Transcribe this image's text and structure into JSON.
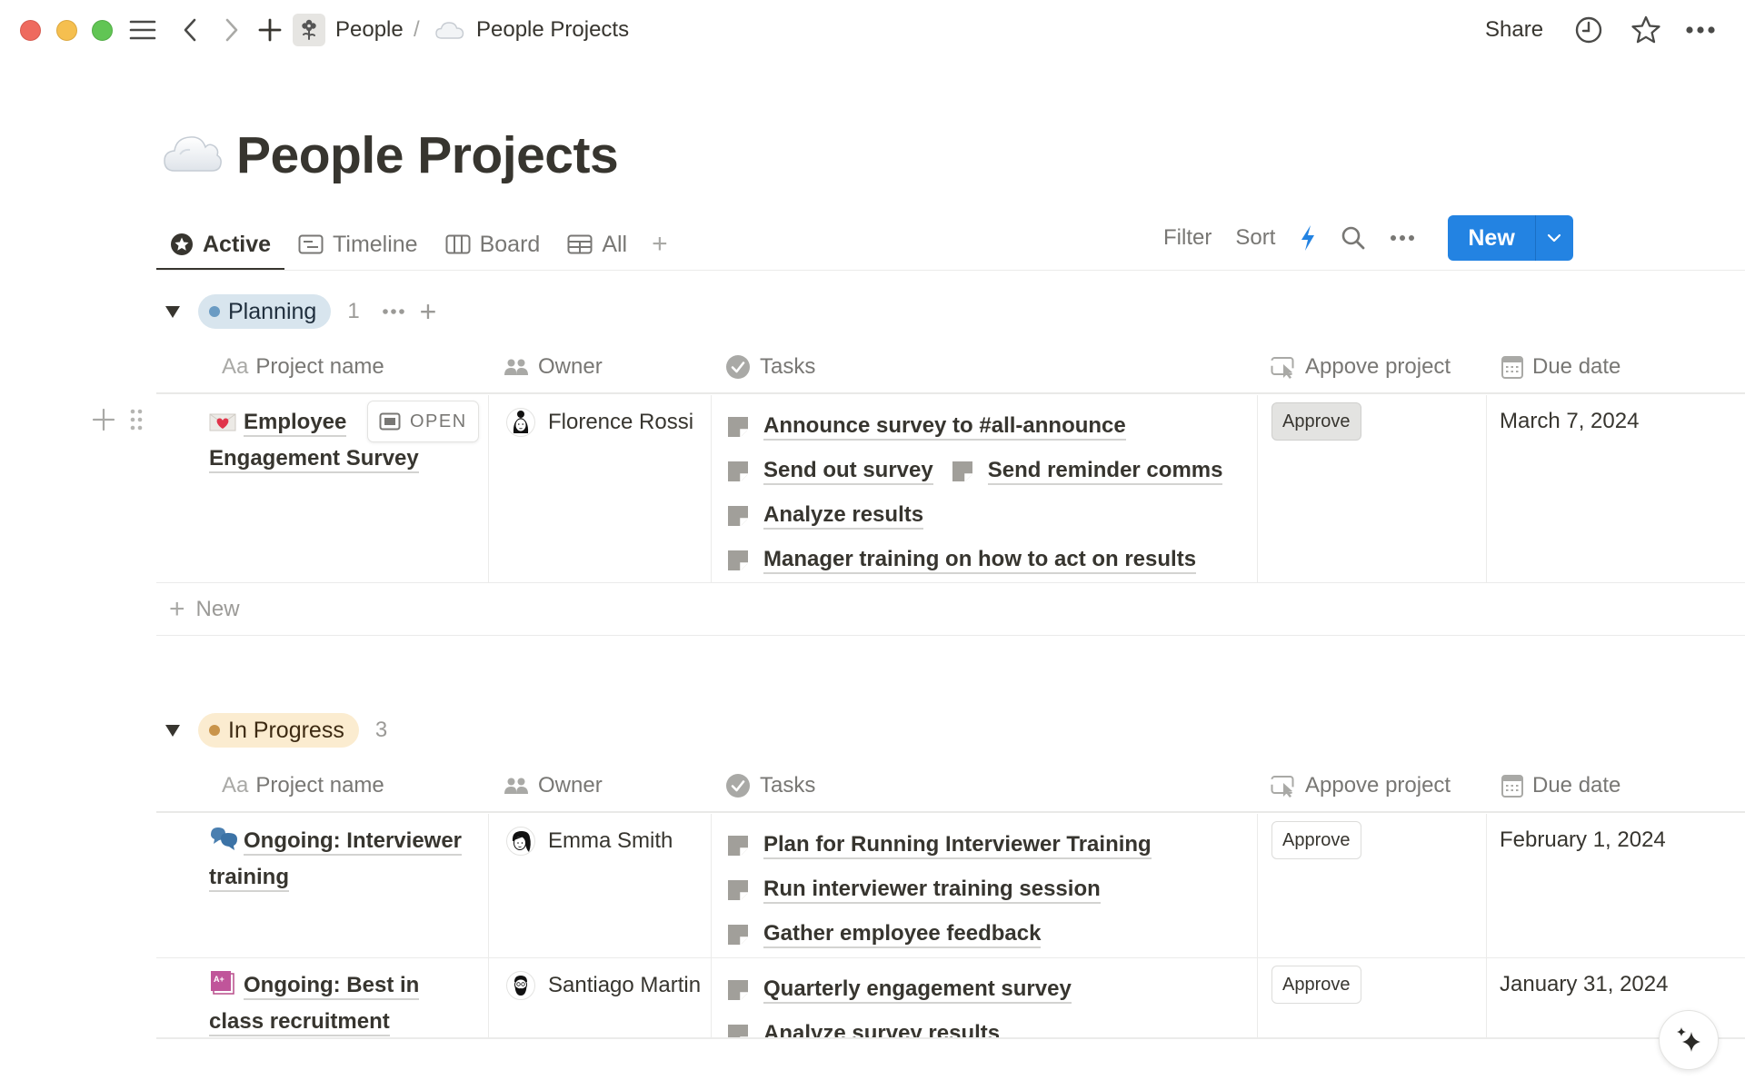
{
  "window": {
    "controls": [
      "close",
      "minimize",
      "maximize"
    ]
  },
  "topbar": {
    "breadcrumb": [
      {
        "label": "People",
        "icon": "flower-icon"
      },
      {
        "label": "People Projects",
        "icon": "cloud-icon"
      }
    ],
    "separator": "/",
    "share_label": "Share"
  },
  "page": {
    "icon": "cloud-icon",
    "title": "People Projects"
  },
  "views": {
    "tabs": [
      {
        "label": "Active",
        "icon": "star-circle-icon",
        "active": true
      },
      {
        "label": "Timeline",
        "icon": "timeline-icon",
        "active": false
      },
      {
        "label": "Board",
        "icon": "board-icon",
        "active": false
      },
      {
        "label": "All",
        "icon": "table-icon",
        "active": false
      }
    ],
    "add_view": "+"
  },
  "toolbar": {
    "filter_label": "Filter",
    "sort_label": "Sort",
    "new_label": "New",
    "accent": "#2383e2"
  },
  "columns": {
    "name": {
      "prefix": "Aa",
      "label": "Project name"
    },
    "owner": {
      "label": "Owner"
    },
    "tasks": {
      "label": "Tasks"
    },
    "approve": {
      "label": "Appove project"
    },
    "due": {
      "label": "Due date"
    }
  },
  "groups": [
    {
      "label": "Planning",
      "count": "1",
      "pill_bg": "#d8e5ee",
      "dot_color": "#6a9bc3",
      "rows": [
        {
          "name": "Employee Engagement Survey",
          "name_line1": "Employee",
          "name_line2": "Engagement Survey",
          "icon": "love-letter-icon",
          "open_label": "OPEN",
          "owner": "Florence Rossi",
          "tasks": [
            [
              "Announce survey to #all-announce"
            ],
            [
              "Send out survey",
              "Send reminder comms"
            ],
            [
              "Analyze results"
            ],
            [
              "Manager training on how to act on results"
            ]
          ],
          "approve_label": "Approve",
          "due": "March 7, 2024"
        }
      ],
      "new_label": "New"
    },
    {
      "label": "In Progress",
      "count": "3",
      "pill_bg": "#fbecd0",
      "dot_color": "#c9944a",
      "rows": [
        {
          "name_line1": "Ongoing: Interviewer",
          "name_line2": "training",
          "icon": "speech-bubbles-icon",
          "owner": "Emma Smith",
          "tasks": [
            [
              "Plan for Running Interviewer Training"
            ],
            [
              "Run interviewer training session"
            ],
            [
              "Gather employee feedback"
            ]
          ],
          "approve_label": "Approve",
          "due": "February 1, 2024"
        },
        {
          "name_line1": "Ongoing: Best in",
          "name_line2": "class recruitment",
          "icon": "grade-a-plus-icon",
          "owner": "Santiago Martin",
          "tasks": [
            [
              "Quarterly engagement survey"
            ],
            [
              "Analyze survey results"
            ]
          ],
          "approve_label": "Approve",
          "due": "January 31, 2024"
        }
      ]
    }
  ]
}
